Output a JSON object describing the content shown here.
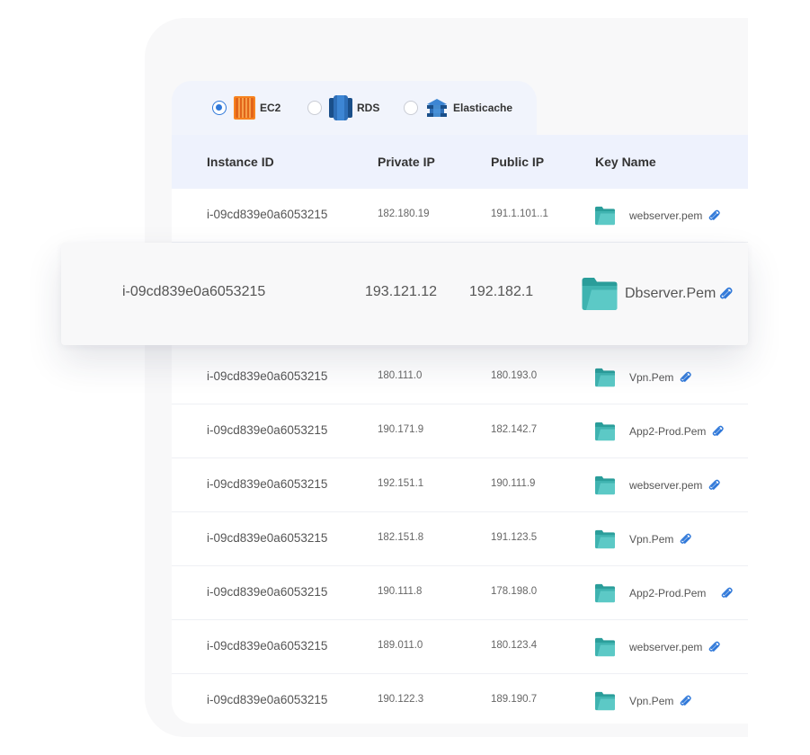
{
  "tabs": [
    {
      "label": "EC2",
      "selected": true,
      "icon": "ec2-icon"
    },
    {
      "label": "RDS",
      "selected": false,
      "icon": "rds-icon"
    },
    {
      "label": "Elasticache",
      "selected": false,
      "icon": "elasticache-icon"
    }
  ],
  "table": {
    "headers": [
      "Instance ID",
      "Private IP",
      "Public IP",
      "Key Name"
    ],
    "rows": [
      {
        "id": "i-09cd839e0a6053215",
        "private_ip": "182.180.19",
        "public_ip": "191.1.101..1",
        "key": "webserver.pem"
      },
      {
        "id": "i-09cd839e0a6053215",
        "private_ip": "180.111.0",
        "public_ip": "180.193.0",
        "key": "Vpn.Pem"
      },
      {
        "id": "i-09cd839e0a6053215",
        "private_ip": "190.171.9",
        "public_ip": "182.142.7",
        "key": "App2-Prod.Pem"
      },
      {
        "id": "i-09cd839e0a6053215",
        "private_ip": "192.151.1",
        "public_ip": "190.111.9",
        "key": "webserver.pem"
      },
      {
        "id": "i-09cd839e0a6053215",
        "private_ip": "182.151.8",
        "public_ip": "191.123.5",
        "key": "Vpn.Pem"
      },
      {
        "id": "i-09cd839e0a6053215",
        "private_ip": "190.111.8",
        "public_ip": "178.198.0",
        "key": "App2-Prod.Pem"
      },
      {
        "id": "i-09cd839e0a6053215",
        "private_ip": "189.011.0",
        "public_ip": "180.123.4",
        "key": "webserver.pem"
      },
      {
        "id": "i-09cd839e0a6053215",
        "private_ip": "190.122.3",
        "public_ip": "189.190.7",
        "key": "Vpn.Pem"
      }
    ]
  },
  "highlighted_row": {
    "id": "i-09cd839e0a6053215",
    "private_ip": "193.121.12",
    "public_ip": "192.182.1",
    "key": "Dbserver.Pem"
  },
  "colors": {
    "accent": "#2f78d9",
    "folder": "#3fb3b0",
    "clip": "#2f78d9",
    "header_bg": "#eef2fd"
  },
  "icons": {
    "folder": "folder-icon",
    "clip": "paperclip-icon"
  }
}
